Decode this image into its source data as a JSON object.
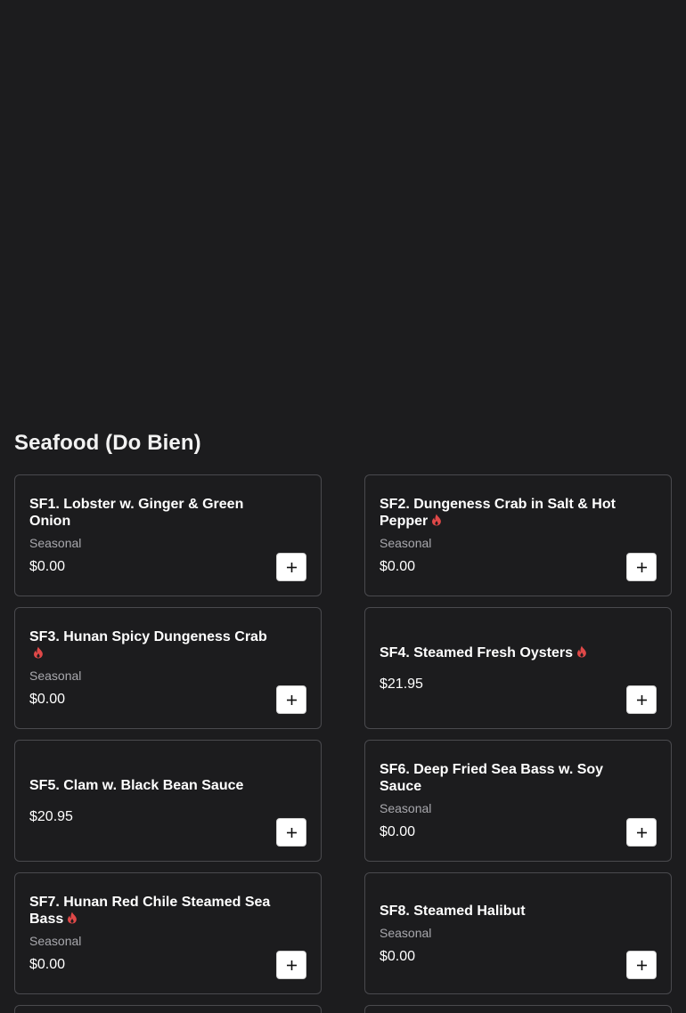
{
  "section": {
    "title": "Seafood (Do Bien)"
  },
  "colors": {
    "background": "#1c1c1e",
    "card_border": "#4a4a4e",
    "spicy": "#e04848"
  },
  "items": [
    {
      "name": "SF1. Lobster w. Ginger & Green Onion",
      "note": "Seasonal",
      "price": "$0.00",
      "spicy": false,
      "add_icon": "plus-icon"
    },
    {
      "name": "SF2. Dungeness Crab in Salt & Hot Pepper",
      "note": "Seasonal",
      "price": "$0.00",
      "spicy": true,
      "add_icon": "plus-icon"
    },
    {
      "name": "SF3. Hunan Spicy Dungeness Crab",
      "note": "Seasonal",
      "price": "$0.00",
      "spicy": true,
      "add_icon": "plus-icon"
    },
    {
      "name": "SF4. Steamed Fresh Oysters",
      "note": "",
      "price": "$21.95",
      "spicy": true,
      "add_icon": "plus-icon"
    },
    {
      "name": "SF5. Clam w. Black Bean Sauce",
      "note": "",
      "price": "$20.95",
      "spicy": false,
      "add_icon": "plus-icon"
    },
    {
      "name": "SF6. Deep Fried Sea Bass w. Soy Sauce",
      "note": "Seasonal",
      "price": "$0.00",
      "spicy": false,
      "add_icon": "plus-icon"
    },
    {
      "name": "SF7. Hunan Red Chile Steamed Sea Bass",
      "note": "Seasonal",
      "price": "$0.00",
      "spicy": true,
      "add_icon": "plus-icon"
    },
    {
      "name": "SF8. Steamed Halibut",
      "note": "Seasonal",
      "price": "$0.00",
      "spicy": false,
      "add_icon": "plus-icon"
    }
  ]
}
